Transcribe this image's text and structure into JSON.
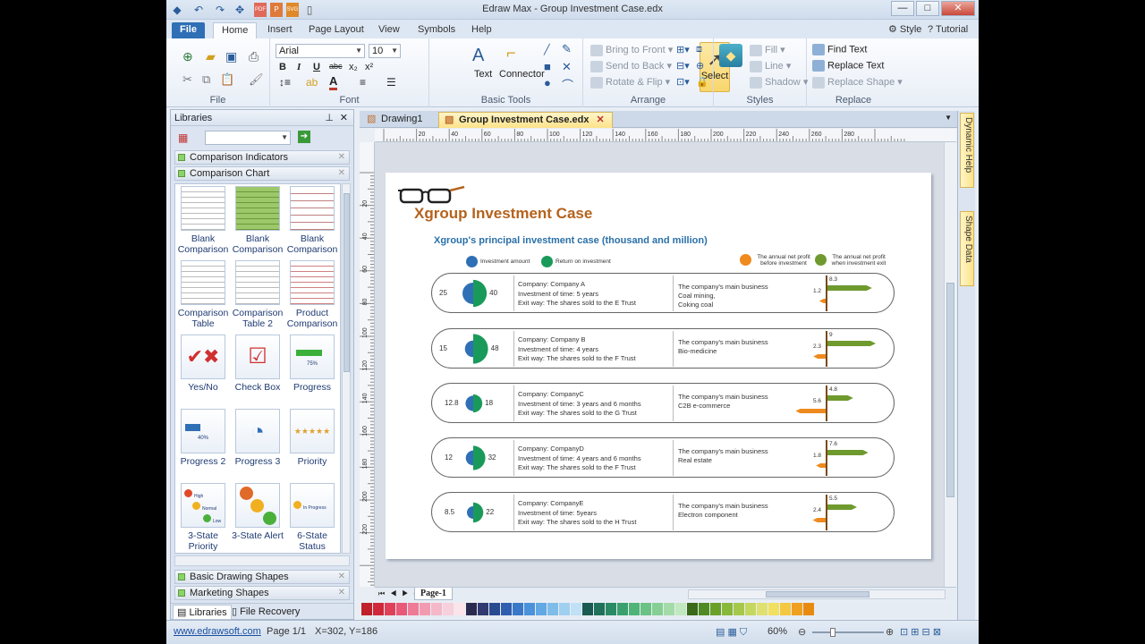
{
  "window": {
    "title": "Edraw Max - Group Investment Case.edx",
    "style_label": "Style",
    "tutorial_label": "Tutorial"
  },
  "ribbon_tabs": [
    "File",
    "Home",
    "Insert",
    "Page Layout",
    "View",
    "Symbols",
    "Help"
  ],
  "ribbon": {
    "file_group": "File",
    "font_group": "Font",
    "font_name": "Arial",
    "font_size": "10",
    "basic_tools_group": "Basic Tools",
    "select_label": "Select",
    "text_label": "Text",
    "connector_label": "Connector",
    "arrange_group": "Arrange",
    "bring_to_front": "Bring to Front",
    "send_to_back": "Send to Back",
    "rotate_flip": "Rotate & Flip",
    "styles_group": "Styles",
    "fill": "Fill",
    "line": "Line",
    "shadow": "Shadow",
    "replace_group": "Replace",
    "find_text": "Find Text",
    "replace_text": "Replace Text",
    "replace_shape": "Replace Shape"
  },
  "libraries": {
    "title": "Libraries",
    "categories_top": [
      "Comparison Indicators",
      "Comparison Chart"
    ],
    "shapes": [
      {
        "label": "Blank Comparison"
      },
      {
        "label": "Blank Comparison"
      },
      {
        "label": "Blank Comparison"
      },
      {
        "label": "Comparison Table"
      },
      {
        "label": "Comparison Table 2"
      },
      {
        "label": "Product Comparison"
      },
      {
        "label": "Yes/No"
      },
      {
        "label": "Check Box"
      },
      {
        "label": "Progress",
        "thumb_text": "75%"
      },
      {
        "label": "Progress 2",
        "thumb_text": "40%"
      },
      {
        "label": "Progress 3"
      },
      {
        "label": "Priority"
      },
      {
        "label": "3-State Priority",
        "thumb_texts": [
          "High",
          "Normal",
          "Low"
        ]
      },
      {
        "label": "3-State Alert"
      },
      {
        "label": "6-State Status",
        "thumb_text": "In Progress"
      }
    ],
    "categories_bottom": [
      "Basic Drawing Shapes",
      "Marketing Shapes"
    ],
    "bottom_tabs": [
      "Libraries",
      "File Recovery"
    ]
  },
  "doc_tabs": [
    "Drawing1",
    "Group Investment Case.edx"
  ],
  "right_tabs": [
    "Dynamic Help",
    "Shape Data"
  ],
  "page_tab": "Page-1",
  "ruler_h": [
    "20",
    "40",
    "60",
    "80",
    "100",
    "120",
    "140",
    "160",
    "180",
    "200",
    "220",
    "240",
    "260",
    "280"
  ],
  "ruler_v": [
    "20",
    "40",
    "60",
    "80",
    "100",
    "120",
    "140",
    "160",
    "180",
    "200",
    "220"
  ],
  "diagram": {
    "title": "Xgroup Investment Case",
    "subtitle": "Xgroup's principal investment case (thousand and million)",
    "legend": {
      "investment": "Investment amount",
      "return": "Return on investment",
      "before": "The annual net profit before investment",
      "after": "The annual net profit when investment exit",
      "color_investment": "#2f6fb6",
      "color_return": "#1a9a5a",
      "color_before": "#ee8a1e",
      "color_after": "#6f9a2e"
    },
    "rows": [
      {
        "inv": "25",
        "ret": "40",
        "company": "Company: Company A",
        "time": "Investment of time: 5 years",
        "exit": "Exit way: The shares sold to the E Trust",
        "biz_title": "The company's main business",
        "biz1": "Coal mining,",
        "biz2": "Coking coal",
        "after": 8.3,
        "before": 1.2,
        "after_label": "8.3",
        "before_label": "1.2"
      },
      {
        "inv": "15",
        "ret": "48",
        "company": "Company: Company B",
        "time": "Investment of time: 4 years",
        "exit": "Exit way: The shares sold to the F Trust",
        "biz_title": "The company's main business",
        "biz1": "Bio-medicine",
        "biz2": "",
        "after": 9,
        "before": 2.3,
        "after_label": "9",
        "before_label": "2.3"
      },
      {
        "inv": "12.8",
        "ret": "18",
        "company": "Company: CompanyC",
        "time": "Investment of time: 3 years and 6 months",
        "exit": "Exit way: The shares sold to the G Trust",
        "biz_title": "The company's main business",
        "biz1": "C2B  e-commerce",
        "biz2": "",
        "after": 4.8,
        "before": 5.6,
        "after_label": "4.8",
        "before_label": "5.6"
      },
      {
        "inv": "12",
        "ret": "32",
        "company": "Company: CompanyD",
        "time": "Investment of time: 4 years and 6 months",
        "exit": "Exit way: The shares sold to the F Trust",
        "biz_title": "The company's main business",
        "biz1": "Real estate",
        "biz2": "",
        "after": 7.6,
        "before": 1.8,
        "after_label": "7.6",
        "before_label": "1.8"
      },
      {
        "inv": "8.5",
        "ret": "22",
        "company": "Company: CompanyE",
        "time": "Investment of time: 5years",
        "exit": "Exit way: The shares sold to the H Trust",
        "biz_title": "The company's main business",
        "biz1": "Electron component",
        "biz2": "",
        "after": 5.5,
        "before": 2.4,
        "after_label": "5.5",
        "before_label": "2.4"
      }
    ]
  },
  "status": {
    "link": "www.edrawsoft.com",
    "page": "Page 1/1",
    "coords": "X=302, Y=186",
    "zoom": "60%"
  }
}
